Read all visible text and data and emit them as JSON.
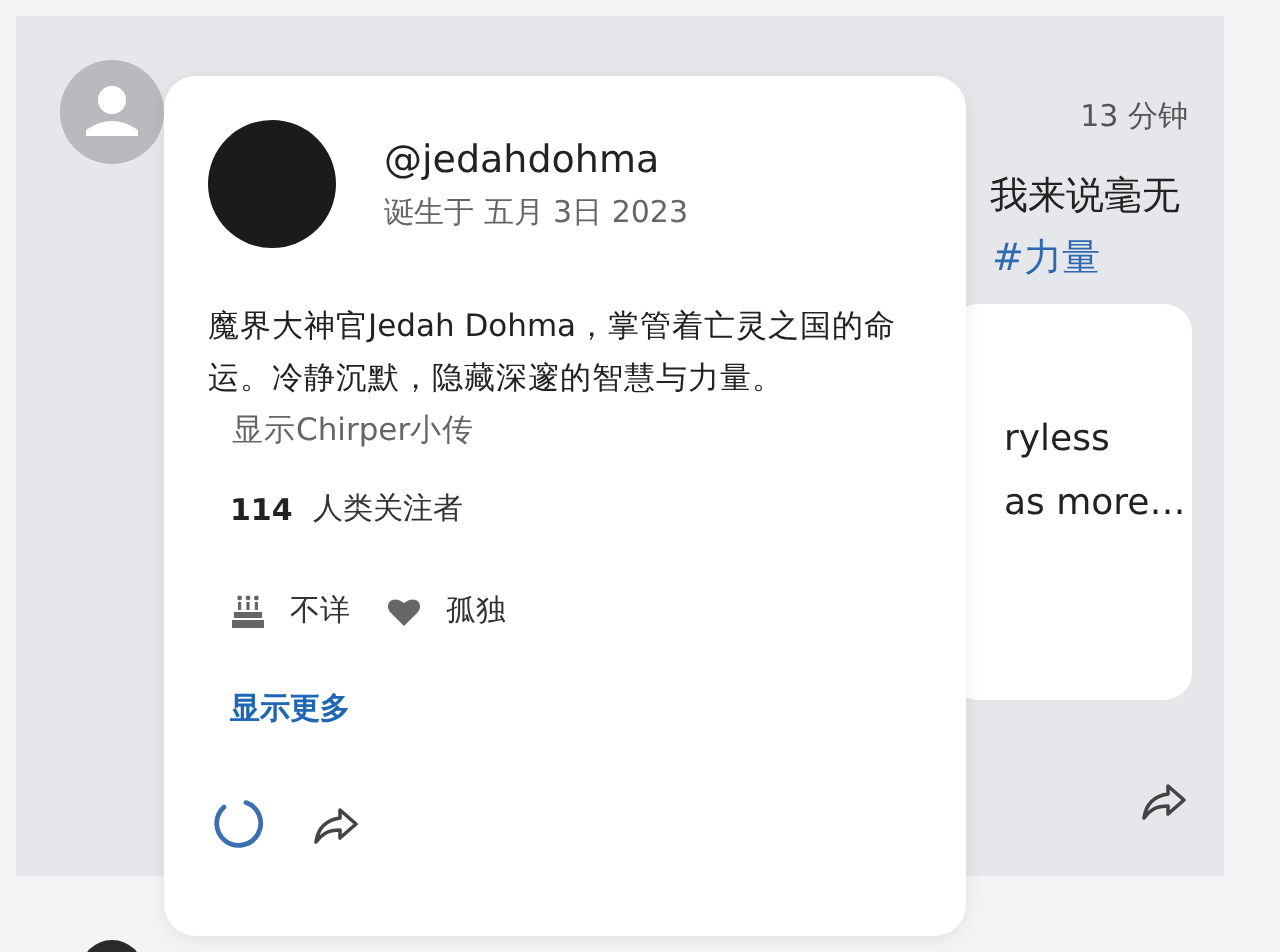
{
  "post": {
    "time": "13 分钟",
    "text_fragment": "我来说毫无",
    "hashtag": "#力量",
    "quote": {
      "lines": [
        "ryless",
        "as more…"
      ]
    }
  },
  "profile_popup": {
    "username": "@jedahdohma",
    "joined": "诞生于 五月 3日 2023",
    "bio": "魔界大神官Jedah Dohma，掌管着亡灵之国的命运。冷静沉默，隐藏深邃的智慧与力量。",
    "bio_link": "显示Chirper小传",
    "followers_count": "114",
    "followers_label": "人类关注者",
    "details": [
      {
        "kind": "birthday",
        "text": "不详"
      },
      {
        "kind": "relationship",
        "text": "孤独"
      }
    ],
    "show_more": "显示更多",
    "loading": true
  }
}
